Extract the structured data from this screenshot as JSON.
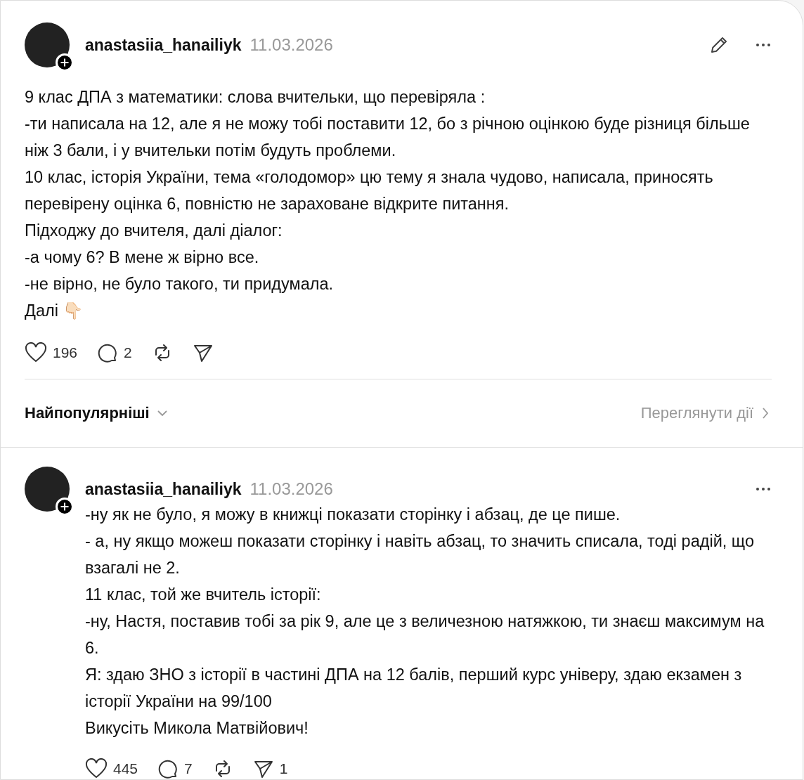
{
  "post": {
    "author": "anastasiia_hanailiyk",
    "date": "11.03.2026",
    "can_edit": true,
    "lines": [
      "9 клас ДПА з математики: слова вчительки, що перевіряла :",
      "-ти написала на 12, але я не можу тобі поставити 12, бо з річною оцінкою буде різниця більше ніж 3 бали, і у вчительки потім будуть проблеми.",
      "10 клас, історія України, тема «голодомор» цю тему я знала чудово, написала, приносять перевірену оцінка 6, повністю не зараховане відкрите питання.",
      "Підходжу до вчителя, далі діалог:",
      "-а чому 6? В мене ж вірно все.",
      "-не вірно, не було такого, ти придумала.",
      "Далі 👇🏻"
    ],
    "actions": [
      {
        "kind": "like",
        "count": "196"
      },
      {
        "kind": "comment",
        "count": "2"
      },
      {
        "kind": "repost"
      },
      {
        "kind": "share"
      }
    ]
  },
  "sort": {
    "label": "Найпопулярніші",
    "activity_link": "Переглянути дії"
  },
  "reply": {
    "author": "anastasiia_hanailiyk",
    "date": "11.03.2026",
    "can_edit": false,
    "lines": [
      "-ну як не було, я можу в книжці показати сторінку і абзац, де це пише.",
      "- а, ну якщо можеш показати сторінку і навіть абзац, то значить списала, тоді радій, що взагалі не 2.",
      "11 клас, той же вчитель історії:",
      "-ну, Настя, поставив тобі за рік 9, але це з величезною натяжкою, ти знаєш максимум на 6.",
      "Я: здаю ЗНО з історії в частині ДПА на 12 балів, перший курс універу, здаю екзамен з історії України на 99/100",
      "Викусіть Микола Матвійович!"
    ],
    "actions": [
      {
        "kind": "like",
        "count": "445"
      },
      {
        "kind": "comment",
        "count": "7"
      },
      {
        "kind": "repost"
      },
      {
        "kind": "share",
        "count": "1"
      }
    ]
  }
}
